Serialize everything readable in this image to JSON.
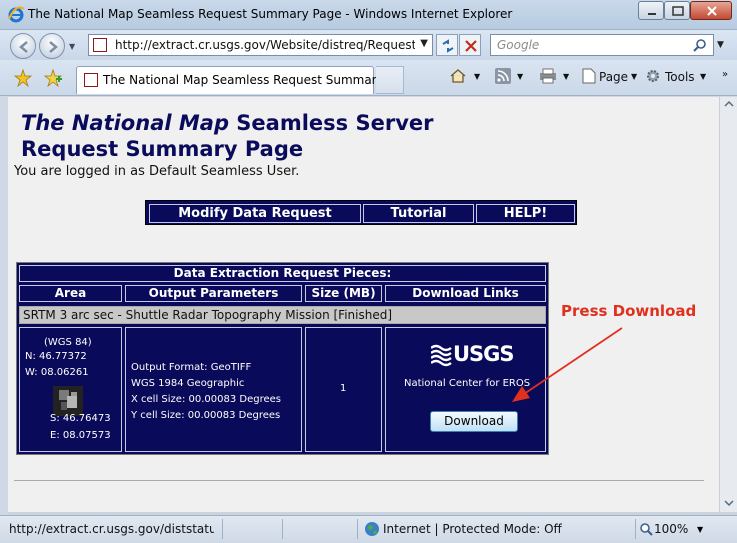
{
  "window": {
    "title": "The National Map Seamless Request Summary Page - Windows Internet Explorer"
  },
  "address_bar": {
    "url": "http://extract.cr.usgs.gov/Website/distreq/RequestSumm"
  },
  "search": {
    "placeholder": "Google"
  },
  "tab": {
    "label": "The National Map Seamless Request Summary P..."
  },
  "toolbar": {
    "page_label": "Page",
    "tools_label": "Tools"
  },
  "page": {
    "heading_italic": "The National Map",
    "heading_rest": " Seamless Server",
    "heading_line2": "Request Summary Page",
    "logged_in": "You are logged in as Default Seamless User.",
    "menu": [
      "Modify Data Request",
      "Tutorial",
      "HELP!"
    ],
    "table": {
      "caption": "Data Extraction Request Pieces:",
      "columns": [
        "Area",
        "Output Parameters",
        "Size (MB)",
        "Download Links"
      ],
      "dataset": "SRTM 3 arc sec - Shuttle Radar Topography Mission [Finished]",
      "area": {
        "datum": "(WGS 84)",
        "north": "N: 46.77372",
        "west": "W: 08.06261",
        "south": "S: 46.76473",
        "east": "E: 08.07573"
      },
      "output": [
        "Output Format: GeoTIFF",
        "WGS 1984 Geographic",
        "X cell Size: 00.00083 Degrees",
        "Y cell Size: 00.00083 Degrees"
      ],
      "size": "1",
      "logo_text": "USGS",
      "center": "National Center for EROS",
      "download_label": "Download"
    },
    "annotation": "Press Download"
  },
  "status": {
    "url": "http://extract.cr.usgs.gov/diststatus/se",
    "zone": "Internet | Protected Mode: Off",
    "zoom": "100%"
  },
  "colors": {
    "page_navy": "#0a0a5a",
    "heading": "#0b0b5c",
    "annotation": "#e0301e"
  }
}
